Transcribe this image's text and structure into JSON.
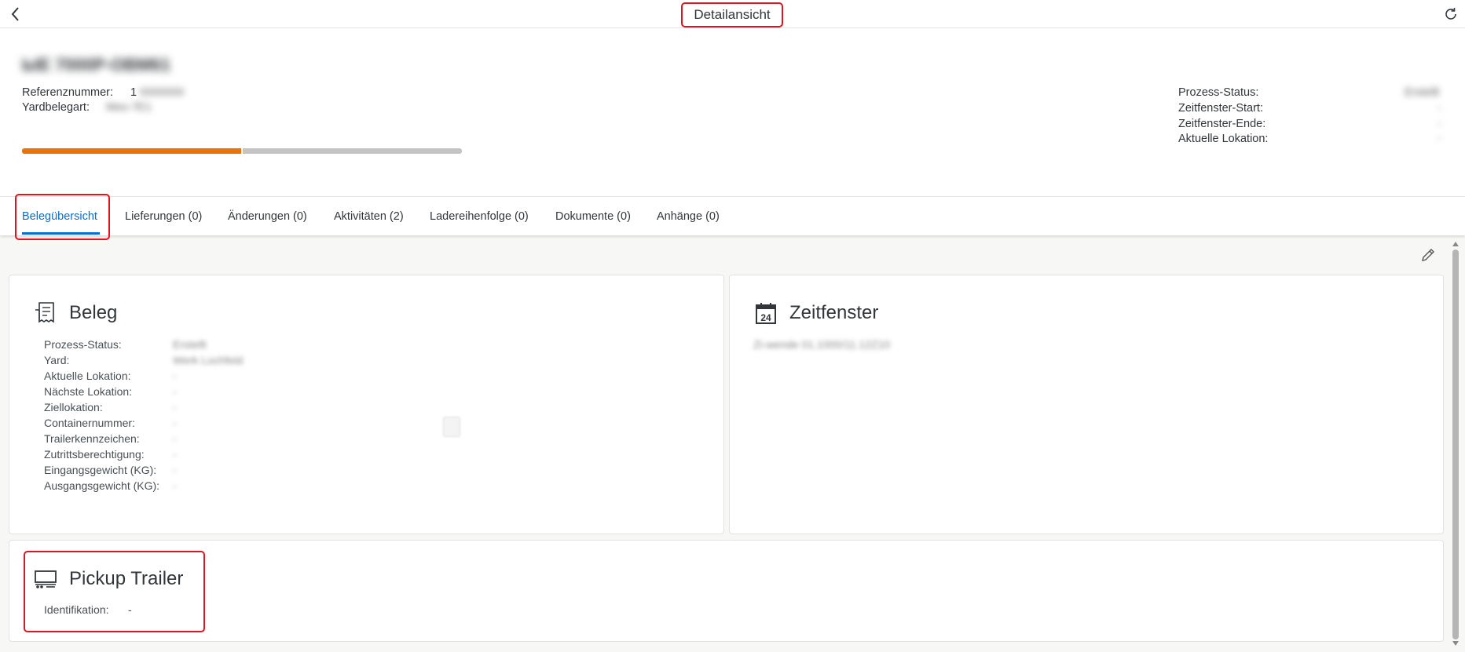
{
  "topbar": {
    "title": "Detailansicht",
    "back_icon": "chevron-left-icon",
    "refresh_icon": "refresh-icon"
  },
  "header": {
    "object_title": "ЫЕ 7000Р-ОВМ61",
    "left_attrs": [
      {
        "label": "Referenznummer:",
        "value": "1"
      },
      {
        "label": "Yardbelegart:",
        "value": "Mes-7E1"
      }
    ],
    "right_attrs": [
      {
        "label": "Prozess-Status:",
        "value": "Erstellt"
      },
      {
        "label": "Zeitfenster-Start:",
        "value": "-"
      },
      {
        "label": "Zeitfenster-Ende:",
        "value": "-"
      },
      {
        "label": "Aktuelle Lokation:",
        "value": "-"
      }
    ],
    "progress_fraction": 0.5,
    "progress_color": "#e8730c"
  },
  "tabs": [
    {
      "label": "Belegübersicht",
      "active": true
    },
    {
      "label": "Lieferungen (0)"
    },
    {
      "label": "Änderungen (0)"
    },
    {
      "label": "Aktivitäten (2)"
    },
    {
      "label": "Ladereihenfolge (0)"
    },
    {
      "label": "Dokumente (0)"
    },
    {
      "label": "Anhänge (0)"
    }
  ],
  "beleg": {
    "title": "Beleg",
    "icon": "receipt-icon",
    "fields": [
      {
        "label": "Prozess-Status:",
        "value": "Erstellt"
      },
      {
        "label": "Yard:",
        "value": "Werk Lochfeld"
      },
      {
        "label": "Aktuelle Lokation:",
        "value": "-"
      },
      {
        "label": "Nächste Lokation:",
        "value": "-"
      },
      {
        "label": "Ziellokation:",
        "value": "-"
      },
      {
        "label": "Containernummer:",
        "value": "-"
      },
      {
        "label": "Trailerkennzeichen:",
        "value": "-"
      },
      {
        "label": "Zutrittsberechtigung:",
        "value": "-"
      },
      {
        "label": "Eingangsgewicht (KG):",
        "value": "-"
      },
      {
        "label": "Ausgangsgewicht (KG):",
        "value": "-"
      }
    ]
  },
  "zeitfenster": {
    "title": "Zeitfenster",
    "icon": "calendar-icon",
    "calendar_number": "24",
    "row": "Zi-wende 01.1000/11.12Z10"
  },
  "pickup": {
    "title": "Pickup Trailer",
    "icon": "trailer-icon",
    "field_label": "Identifikation:",
    "field_value": "-"
  },
  "edit_icon": "pencil-icon"
}
